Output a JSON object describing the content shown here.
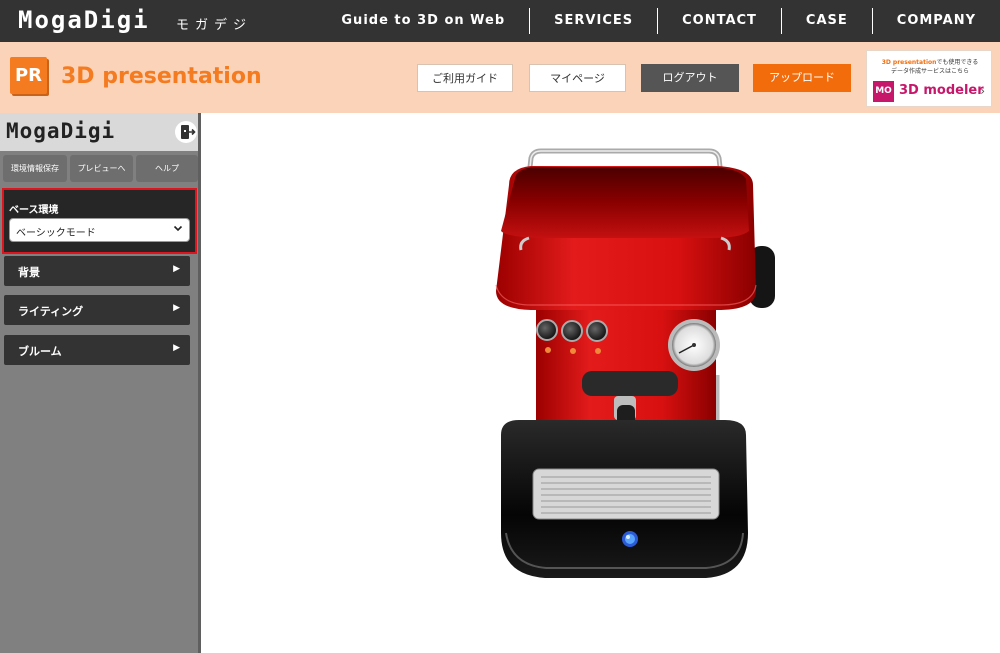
{
  "topnav": {
    "logo": "MogaDigi",
    "logo_kana": "モガデジ",
    "links": [
      {
        "label": "Guide to 3D on Web"
      },
      {
        "label": "SERVICES"
      },
      {
        "label": "CONTACT"
      },
      {
        "label": "CASE"
      },
      {
        "label": "COMPANY"
      }
    ]
  },
  "header": {
    "badge": "PR",
    "title": "3D presentation",
    "buttons": {
      "guide": "ご利用ガイド",
      "mypage": "マイページ",
      "logout": "ログアウト",
      "upload": "アップロード"
    },
    "promo": {
      "line1_highlight": "3D presentation",
      "line1_rest": "でも使用できる",
      "line2": "データ作成サービスはこちら",
      "badge": "MO",
      "name": "3D modeler",
      "chevron": "›"
    }
  },
  "sidebar": {
    "logo": "MogaDigi",
    "tabs": {
      "save": "環境情報保存",
      "preview": "プレビューへ",
      "help": "ヘルプ"
    },
    "base_env": {
      "label": "ベース環境",
      "selected": "ベーシックモード"
    },
    "sections": [
      {
        "label": "背景"
      },
      {
        "label": "ライティング"
      },
      {
        "label": "ブルーム"
      }
    ]
  },
  "colors": {
    "accent_orange": "#f36c0b",
    "nav_dark": "#333333",
    "band_peach": "#fbd3b8",
    "machine_red": "#d01010",
    "highlight_red": "#e0141e"
  }
}
